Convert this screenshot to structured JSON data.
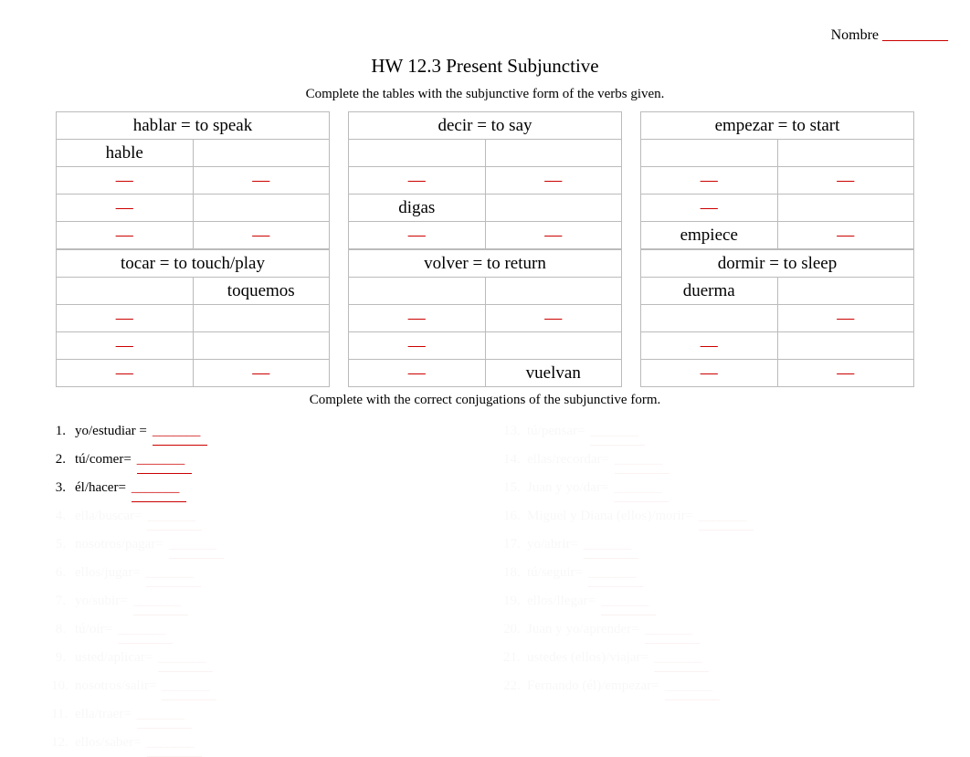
{
  "header": {
    "nombre_label": "Nombre",
    "nombre_blank": "_________"
  },
  "title": "HW 12.3 Present Subjunctive",
  "instruction1": "Complete the tables with the subjunctive form of the verbs given.",
  "tables": [
    [
      {
        "header": "hablar = to speak",
        "cells": [
          [
            "hable",
            ""
          ],
          [
            "—",
            "—"
          ],
          [
            "—",
            ""
          ],
          [
            "—",
            "—"
          ]
        ]
      },
      {
        "header": "tocar = to touch/play",
        "cells": [
          [
            "",
            "toquemos"
          ],
          [
            "—",
            ""
          ],
          [
            "—",
            ""
          ],
          [
            "—",
            "—"
          ]
        ]
      }
    ],
    [
      {
        "header": "decir = to say",
        "cells": [
          [
            "",
            ""
          ],
          [
            "—",
            "—"
          ],
          [
            "digas",
            ""
          ],
          [
            "—",
            "—"
          ]
        ]
      },
      {
        "header": "volver = to return",
        "cells": [
          [
            "",
            ""
          ],
          [
            "—",
            "—"
          ],
          [
            "—",
            ""
          ],
          [
            "—",
            "vuelvan"
          ]
        ]
      }
    ],
    [
      {
        "header": "empezar = to start",
        "cells": [
          [
            "",
            ""
          ],
          [
            "—",
            "—"
          ],
          [
            "—",
            ""
          ],
          [
            "empiece",
            "—"
          ]
        ]
      },
      {
        "header": "dormir = to sleep",
        "cells": [
          [
            "duerma",
            ""
          ],
          [
            "",
            "—"
          ],
          [
            "—",
            ""
          ],
          [
            "—",
            "—"
          ]
        ]
      }
    ]
  ],
  "instruction2": "Complete with the correct conjugations of the subjunctive form.",
  "fills_left": [
    {
      "num": "1.",
      "prompt": "yo/estudiar =",
      "blank": "_______",
      "faded": false
    },
    {
      "num": "2.",
      "prompt": "tú/comer=",
      "blank": "_______",
      "faded": false
    },
    {
      "num": "3.",
      "prompt": "él/hacer=",
      "blank": "_______",
      "faded": false
    },
    {
      "num": "4.",
      "prompt": "ella/buscar=",
      "blank": "_______",
      "faded": true
    },
    {
      "num": "5.",
      "prompt": "nosotros/pagar=",
      "blank": "_______",
      "faded": true
    },
    {
      "num": "6.",
      "prompt": "ellos/jugar=",
      "blank": "_______",
      "faded": true
    },
    {
      "num": "7.",
      "prompt": "yo/subir=",
      "blank": "_______",
      "faded": true
    },
    {
      "num": "8.",
      "prompt": "tú/oír=",
      "blank": "_______",
      "faded": true
    },
    {
      "num": "9.",
      "prompt": "usted/aplicar=",
      "blank": "_______",
      "faded": true
    },
    {
      "num": "10.",
      "prompt": "nosotros/salir=",
      "blank": "_______",
      "faded": true
    },
    {
      "num": "11.",
      "prompt": "ella/traer=",
      "blank": "_______",
      "faded": true
    },
    {
      "num": "12.",
      "prompt": "ellos/saber=",
      "blank": "_______",
      "faded": true
    }
  ],
  "fills_right": [
    {
      "num": "13.",
      "prompt": "tú/pensar=",
      "blank": "_______",
      "faded": true
    },
    {
      "num": "14.",
      "prompt": "ellas/recordar=",
      "blank": "_______",
      "faded": true
    },
    {
      "num": "15.",
      "prompt": "Juan y yo/dar=",
      "blank": "_______",
      "faded": true
    },
    {
      "num": "16.",
      "prompt": "Miguel y Diana (ellos)/morir=",
      "blank": "_______",
      "faded": true
    },
    {
      "num": "17.",
      "prompt": "yo/abrir=",
      "blank": "_______",
      "faded": true
    },
    {
      "num": "18.",
      "prompt": "tú/seguir=",
      "blank": "_______",
      "faded": true
    },
    {
      "num": "19.",
      "prompt": "ellos/llegar=",
      "blank": "_______",
      "faded": true
    },
    {
      "num": "20.",
      "prompt": "Juan y yo/aprender=",
      "blank": "_______",
      "faded": true
    },
    {
      "num": "21.",
      "prompt": "ustedes (ellos)/viajar=",
      "blank": "_______",
      "faded": true
    },
    {
      "num": "22.",
      "prompt": "Fernando (él)/empezar=",
      "blank": "_______",
      "faded": true
    }
  ]
}
